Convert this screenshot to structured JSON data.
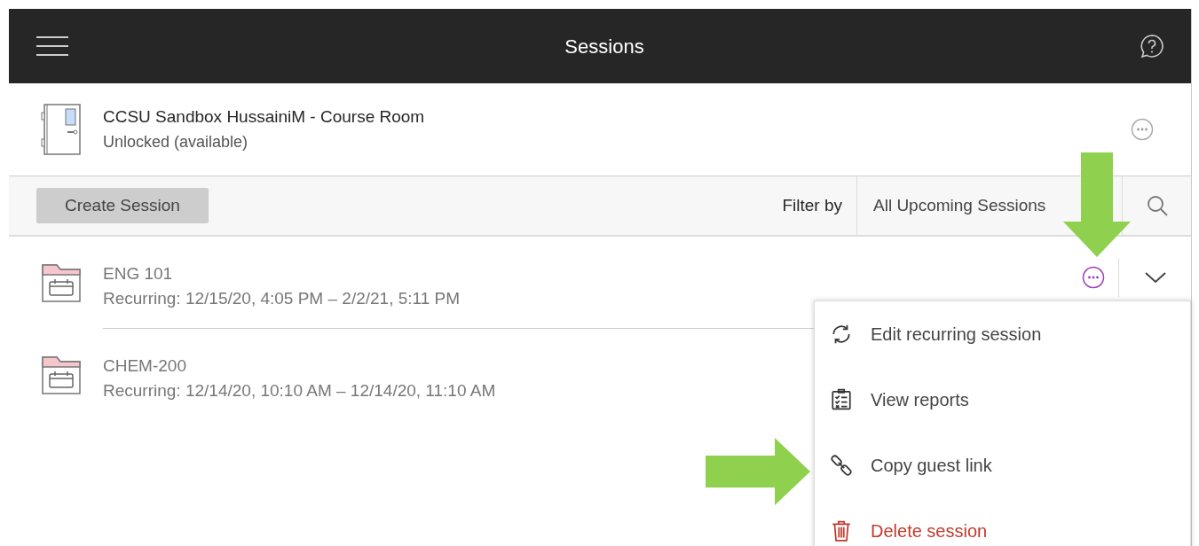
{
  "header": {
    "title": "Sessions"
  },
  "room": {
    "name": "CCSU Sandbox HussainiM - Course Room",
    "status": "Unlocked (available)"
  },
  "toolbar": {
    "create_button": "Create Session",
    "filter_label": "Filter by",
    "filter_value": "All Upcoming Sessions"
  },
  "sessions": [
    {
      "name": "ENG 101",
      "schedule": "Recurring: 12/15/20, 4:05 PM – 2/2/21, 5:11 PM",
      "menu_open": true
    },
    {
      "name": "CHEM-200",
      "schedule": "Recurring: 12/14/20, 10:10 AM – 12/14/20, 11:10 AM",
      "menu_open": false
    }
  ],
  "session_menu": [
    {
      "label": "Edit recurring session",
      "danger": false
    },
    {
      "label": "View reports",
      "danger": false
    },
    {
      "label": "Copy guest link",
      "danger": false
    },
    {
      "label": "Delete session",
      "danger": true
    }
  ]
}
